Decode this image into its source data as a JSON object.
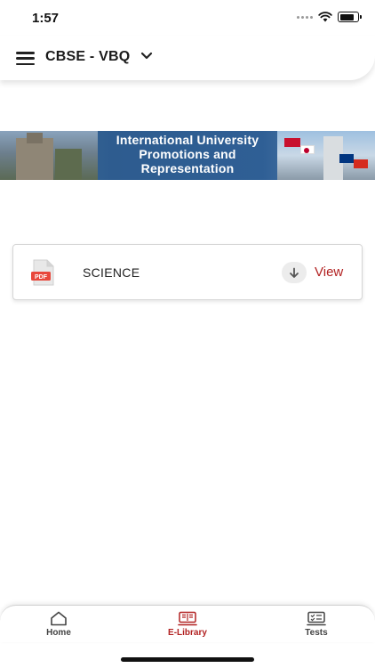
{
  "status_bar": {
    "time": "1:57",
    "icons": [
      "signal-icon",
      "wifi-icon",
      "battery-icon"
    ],
    "battery_level": 0.8
  },
  "header": {
    "title": "CBSE - VBQ",
    "menu_icon": "hamburger-menu-icon",
    "dropdown_icon": "chevron-down-icon"
  },
  "banner": {
    "line1": "International University",
    "line2": "Promotions and",
    "line3": "Representation"
  },
  "documents": [
    {
      "icon": "pdf-file-icon",
      "icon_label": "PDF",
      "title": "SCIENCE",
      "download_icon": "arrow-down-icon",
      "action_label": "View"
    }
  ],
  "bottom_nav": {
    "items": [
      {
        "label": "Home",
        "icon": "home-icon",
        "active": false
      },
      {
        "label": "E-Library",
        "icon": "library-icon",
        "active": true
      },
      {
        "label": "Tests",
        "icon": "tests-checklist-icon",
        "active": false
      }
    ]
  },
  "colors": {
    "accent": "#b22222",
    "banner_blue": "#2e5c8f",
    "text": "#1a1a1a"
  }
}
